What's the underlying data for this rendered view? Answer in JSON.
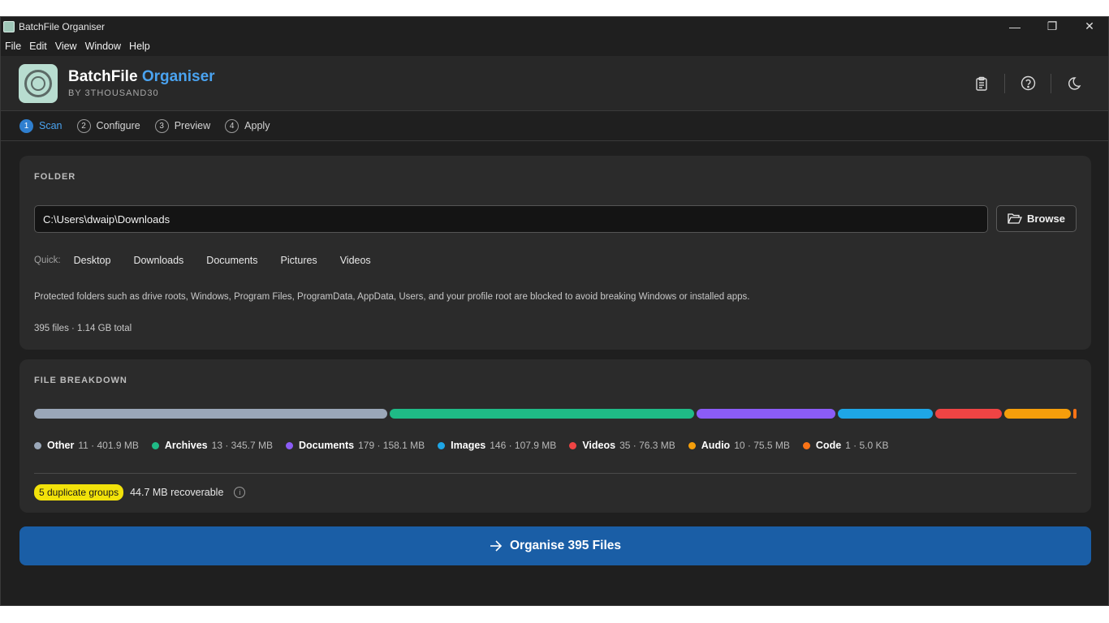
{
  "window": {
    "title": "BatchFile Organiser",
    "minimize_glyph": "—",
    "restore_glyph": "❐",
    "close_glyph": "✕"
  },
  "menu": [
    "File",
    "Edit",
    "View",
    "Window",
    "Help"
  ],
  "header": {
    "brand_main": "BatchFile",
    "brand_accent": "Organiser",
    "byline": "BY 3THOUSAND30",
    "tools": [
      "clipboard-icon",
      "help-icon",
      "moon-icon"
    ]
  },
  "steps": [
    {
      "num": "1",
      "label": "Scan",
      "active": true
    },
    {
      "num": "2",
      "label": "Configure",
      "active": false
    },
    {
      "num": "3",
      "label": "Preview",
      "active": false
    },
    {
      "num": "4",
      "label": "Apply",
      "active": false
    }
  ],
  "folder": {
    "title": "FOLDER",
    "path": "C:\\Users\\dwaip\\Downloads",
    "browse_label": "Browse",
    "quick_label": "Quick:",
    "quick_items": [
      "Desktop",
      "Downloads",
      "Documents",
      "Pictures",
      "Videos"
    ],
    "notice": "Protected folders such as drive roots, Windows, Program Files, ProgramData, AppData, Users, and your profile root are blocked to avoid breaking Windows or installed apps.",
    "totals": "395 files · 1.14 GB total"
  },
  "breakdown": {
    "title": "FILE BREAKDOWN",
    "categories": [
      {
        "name": "Other",
        "stat": "11 · 401.9 MB",
        "size_mb": 401.9,
        "color": "#9aa7b8"
      },
      {
        "name": "Archives",
        "stat": "13 · 345.7 MB",
        "size_mb": 345.7,
        "color": "#1fba86"
      },
      {
        "name": "Documents",
        "stat": "179 · 158.1 MB",
        "size_mb": 158.1,
        "color": "#8b5cf6"
      },
      {
        "name": "Images",
        "stat": "146 · 107.9 MB",
        "size_mb": 107.9,
        "color": "#1ea6e6"
      },
      {
        "name": "Videos",
        "stat": "35 · 76.3 MB",
        "size_mb": 76.3,
        "color": "#ef4444"
      },
      {
        "name": "Audio",
        "stat": "10 · 75.5 MB",
        "size_mb": 75.5,
        "color": "#f59e0b"
      },
      {
        "name": "Code",
        "stat": "1 · 5.0 KB",
        "size_mb": 0.005,
        "color": "#f97316"
      }
    ],
    "duplicate_badge": "5 duplicate groups",
    "recoverable": "44.7 MB recoverable"
  },
  "action": {
    "label": "Organise 395 Files"
  }
}
